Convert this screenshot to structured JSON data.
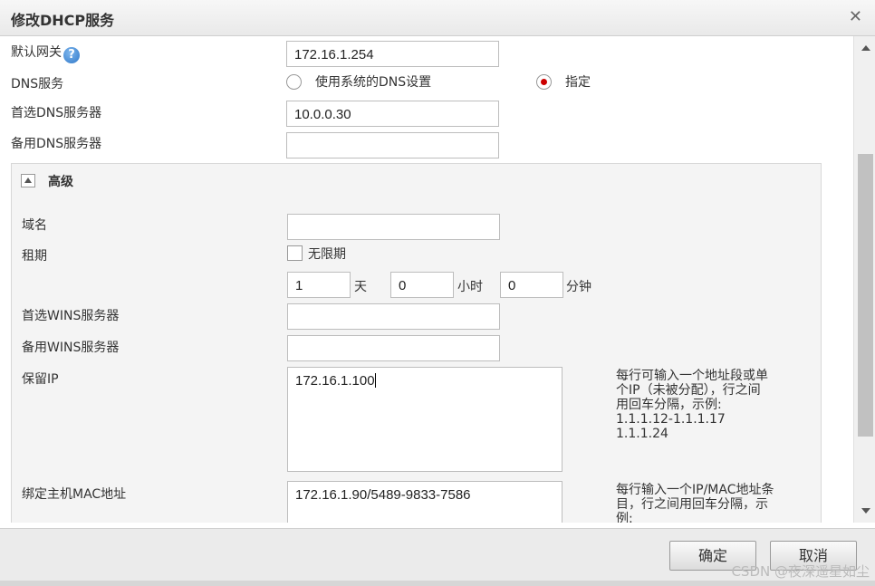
{
  "dialog": {
    "title": "修改DHCP服务"
  },
  "fields": {
    "gateway": {
      "label": "默认网关",
      "value": "172.16.1.254"
    },
    "dns": {
      "label": "DNS服务",
      "option_system": "使用系统的DNS设置",
      "option_specify": "指定",
      "selected": "指定"
    },
    "preferred_dns": {
      "label": "首选DNS服务器",
      "value": "10.0.0.30"
    },
    "backup_dns": {
      "label": "备用DNS服务器",
      "value": ""
    }
  },
  "advanced": {
    "title": "高级",
    "domain": {
      "label": "域名",
      "value": ""
    },
    "lease": {
      "label": "租期",
      "unlimited_label": "无限期",
      "days": "1",
      "days_unit": "天",
      "hours": "0",
      "hours_unit": "小时",
      "minutes": "0",
      "minutes_unit": "分钟"
    },
    "preferred_wins": {
      "label": "首选WINS服务器",
      "value": ""
    },
    "backup_wins": {
      "label": "备用WINS服务器",
      "value": ""
    },
    "reserved_ip": {
      "label": "保留IP",
      "value": "172.16.1.100",
      "hint": [
        "每行可输入一个地址段或单",
        "个IP（未被分配），行之间",
        "用回车分隔，示例:",
        "1.1.1.12-1.1.1.17",
        "1.1.1.24"
      ]
    },
    "bind_mac": {
      "label": "绑定主机MAC地址",
      "value": "172.16.1.90/5489-9833-7586",
      "hint": [
        "每行输入一个IP/MAC地址条",
        "目，行之间用回车分隔，示",
        "例:"
      ]
    }
  },
  "footer": {
    "ok": "确定",
    "cancel": "取消",
    "watermark": "CSDN @夜深遥星如尘"
  },
  "icons": {
    "help": "help-circle-icon",
    "close": "close-icon"
  }
}
